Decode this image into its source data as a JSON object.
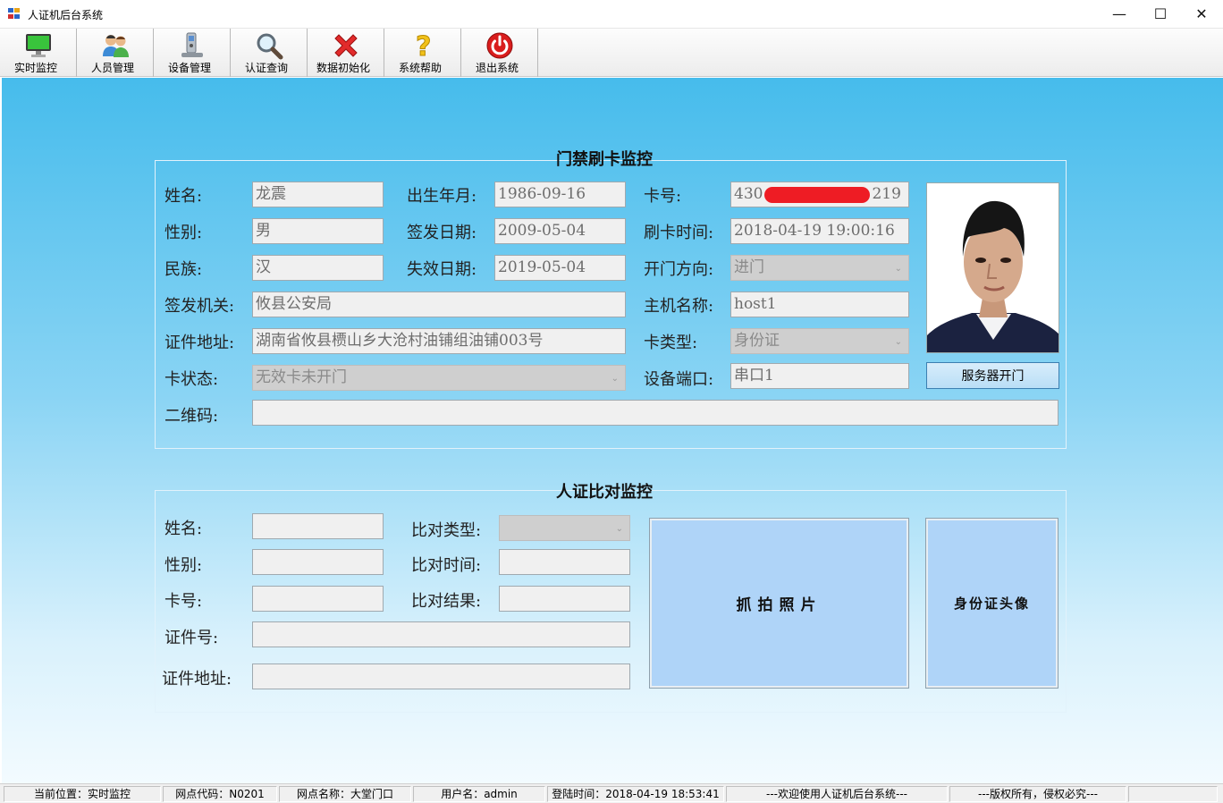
{
  "window": {
    "title": "人证机后台系统",
    "minimize": "—",
    "maximize": "☐",
    "close": "✕"
  },
  "toolbar": [
    {
      "label": "实时监控",
      "icon": "monitor-icon"
    },
    {
      "label": "人员管理",
      "icon": "users-icon"
    },
    {
      "label": "设备管理",
      "icon": "device-icon"
    },
    {
      "label": "认证查询",
      "icon": "magnifier-icon"
    },
    {
      "label": "数据初始化",
      "icon": "red-x-icon"
    },
    {
      "label": "系统帮助",
      "icon": "question-icon"
    },
    {
      "label": "退出系统",
      "icon": "power-icon"
    }
  ],
  "access": {
    "title": "门禁刷卡监控",
    "name_label": "姓名:",
    "name": "龙震",
    "gender_label": "性别:",
    "gender": "男",
    "ethnic_label": "民族:",
    "ethnic": "汉",
    "authority_label": "签发机关:",
    "authority": "攸县公安局",
    "address_label": "证件地址:",
    "address": "湖南省攸县槚山乡大沧村油铺组油铺003号",
    "card_status_label": "卡状态:",
    "card_status": "无效卡未开门",
    "qr_label": "二维码:",
    "qr": "",
    "birth_label": "出生年月:",
    "birth": "1986-09-16",
    "issue_label": "签发日期:",
    "issue": "2009-05-04",
    "expire_label": "失效日期:",
    "expire": "2019-05-04",
    "cardno_label": "卡号:",
    "cardno_prefix": "430",
    "cardno_suffix": "219",
    "swipe_time_label": "刷卡时间:",
    "swipe_time": "2018-04-19 19:00:16",
    "direction_label": "开门方向:",
    "direction": "进门",
    "host_label": "主机名称:",
    "host": "host1",
    "card_type_label": "卡类型:",
    "card_type": "身份证",
    "port_label": "设备端口:",
    "port": "串口1",
    "open_button": "服务器开门"
  },
  "compare": {
    "title": "人证比对监控",
    "name_label": "姓名:",
    "gender_label": "性别:",
    "cardno_label": "卡号:",
    "idno_label": "证件号:",
    "address_label": "证件地址:",
    "type_label": "比对类型:",
    "time_label": "比对时间:",
    "result_label": "比对结果:",
    "snapshot_label": "抓拍照片",
    "idphoto_label": "身份证头像"
  },
  "status": [
    "当前位置：实时监控",
    "网点代码：N0201",
    "网点名称：大堂门口",
    "用户名：admin",
    "登陆时间：2018-04-19 18:53:41",
    "---欢迎使用人证机后台系统---",
    "---版权所有，侵权必究---"
  ],
  "colors": {
    "accent": "#46bcec",
    "redaction": "#ee1c24",
    "panel": "#afd4f8"
  }
}
